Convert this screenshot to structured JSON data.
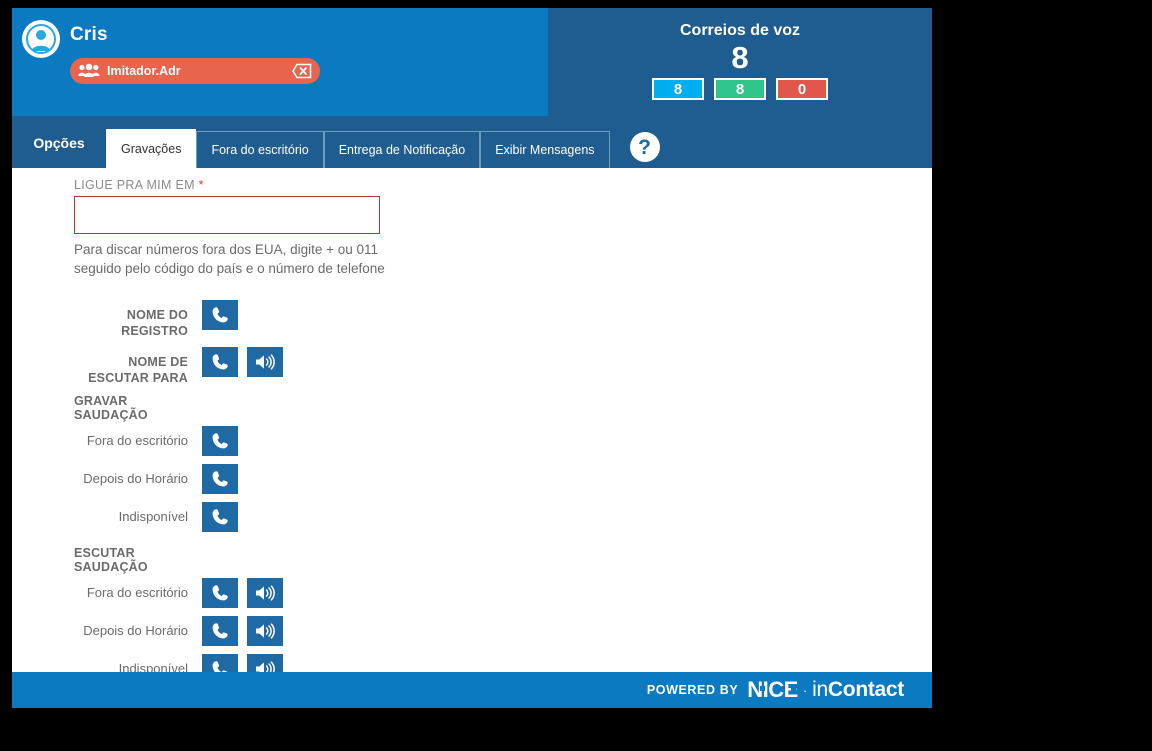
{
  "header": {
    "avatar_icon": "user-avatar-icon",
    "user_name": "Cris",
    "badge": {
      "group_icon": "group-people-icon",
      "label": "Imitador.Adr",
      "close_icon": "close-x-icon",
      "color": "#e8644c"
    },
    "voicemail": {
      "title": "Correios de voz",
      "total": "8",
      "pills": [
        {
          "value": "8",
          "color": "#00aeef",
          "name": "new-voicemails-pill"
        },
        {
          "value": "8",
          "color": "#2ec48a",
          "name": "saved-voicemails-pill"
        },
        {
          "value": "0",
          "color": "#e2574c",
          "name": "urgent-voicemails-pill"
        }
      ]
    },
    "left_bg": "#0b7ac0",
    "right_bg": "#1f5c8f"
  },
  "tabbar": {
    "menu_label": "Opções",
    "tabs": [
      {
        "label": "Gravações",
        "active": true
      },
      {
        "label": "Fora do escritório",
        "active": false
      },
      {
        "label": "Entrega de Notificação",
        "active": false
      },
      {
        "label": "Exibir Mensagens",
        "active": false
      }
    ],
    "help_icon": "question-mark-icon",
    "help_glyph": "?"
  },
  "form": {
    "phone_label": "LIGUE PRA MIM EM",
    "required_mark": "*",
    "phone_value": "",
    "phone_placeholder": "",
    "hint_line1": "Para discar números fora dos EUA, digite + ou 011",
    "hint_line2": "seguido pelo código do país e o número de telefone",
    "border_color": "#b23c3c"
  },
  "recordings": {
    "record_name_label": "NOME DO REGISTRO",
    "listen_name_label": "NOME DE ESCUTAR PARA",
    "record_section_title": "GRAVAR SAUDAÇÃO",
    "listen_section_title": "ESCUTAR SAUDAÇÃO",
    "record_rows": [
      {
        "label": "Fora do escritório"
      },
      {
        "label": "Depois do Horário"
      },
      {
        "label": "Indisponível"
      }
    ],
    "listen_rows": [
      {
        "label": "Fora do escritório"
      },
      {
        "label": "Depois do Horário"
      },
      {
        "label": "Indisponível"
      }
    ],
    "phone_icon": "phone-handset-icon",
    "speaker_icon": "speaker-volume-icon",
    "button_color": "#1f6aa5"
  },
  "footer": {
    "powered_by": "POWERED BY",
    "brand_nice": "NICE",
    "separator": "·",
    "brand_in": "in",
    "brand_contact": "Contact",
    "bg": "#0b7ac0"
  }
}
